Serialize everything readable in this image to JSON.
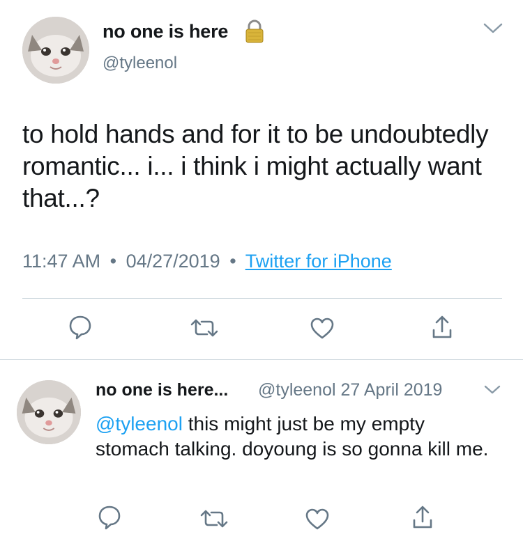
{
  "tweet": {
    "display_name": "no one is here",
    "lock_icon": "lock-icon",
    "handle": "@tyleenol",
    "text": "to hold hands and for it to be undoubtedly romantic... i... i think i might actually want that...?",
    "time": "11:47 AM",
    "date": "04/27/2019",
    "separator": "•",
    "source": "Twitter for iPhone",
    "actions": [
      "reply-icon",
      "retweet-icon",
      "like-icon",
      "share-icon"
    ]
  },
  "reply": {
    "display_name": "no one is here...",
    "handle_date": "@tyleenol 27 April 2019",
    "mention": "@tyleenol",
    "text": " this might just be my empty stomach talking. doyoung is so gonna kill me.",
    "actions": [
      "reply-icon",
      "retweet-icon",
      "like-icon",
      "share-icon"
    ]
  },
  "colors": {
    "text": "#14171a",
    "secondary": "#657786",
    "link": "#1da1f2",
    "divider": "#ccd6dd",
    "icon": "#657786"
  }
}
